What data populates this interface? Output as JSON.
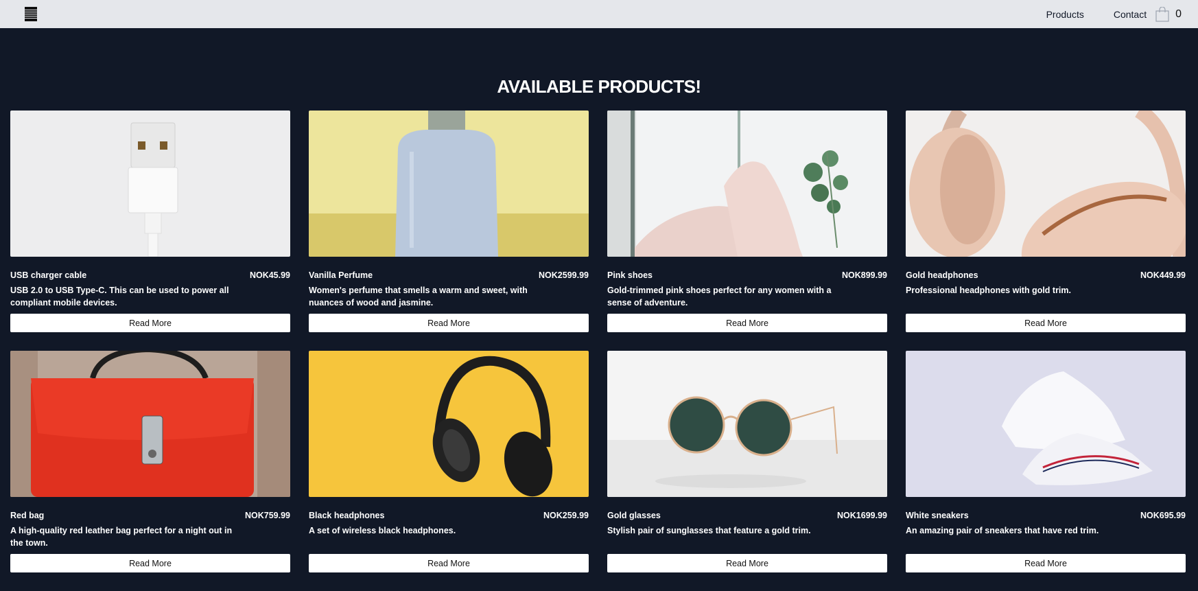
{
  "nav": {
    "products_label": "Products",
    "contact_label": "Contact",
    "cart_count": "0"
  },
  "heading": "AVAILABLE PRODUCTS!",
  "read_more_label": "Read More",
  "products": [
    {
      "title": "USB charger cable",
      "price": "NOK45.99",
      "description": "USB 2.0 to USB Type-C. This can be used to power all compliant mobile devices."
    },
    {
      "title": "Vanilla Perfume",
      "price": "NOK2599.99",
      "description": "Women's perfume that smells a warm and sweet, with nuances of wood and jasmine."
    },
    {
      "title": "Pink shoes",
      "price": "NOK899.99",
      "description": "Gold-trimmed pink shoes perfect for any women with a sense of adventure."
    },
    {
      "title": "Gold headphones",
      "price": "NOK449.99",
      "description": "Professional headphones with gold trim."
    },
    {
      "title": "Red bag",
      "price": "NOK759.99",
      "description": "A high-quality red leather bag perfect for a night out in the town."
    },
    {
      "title": "Black headphones",
      "price": "NOK259.99",
      "description": "A set of wireless black headphones."
    },
    {
      "title": "Gold glasses",
      "price": "NOK1699.99",
      "description": "Stylish pair of sunglasses that feature a gold trim."
    },
    {
      "title": "White sneakers",
      "price": "NOK695.99",
      "description": "An amazing pair of sneakers that have red trim."
    }
  ]
}
